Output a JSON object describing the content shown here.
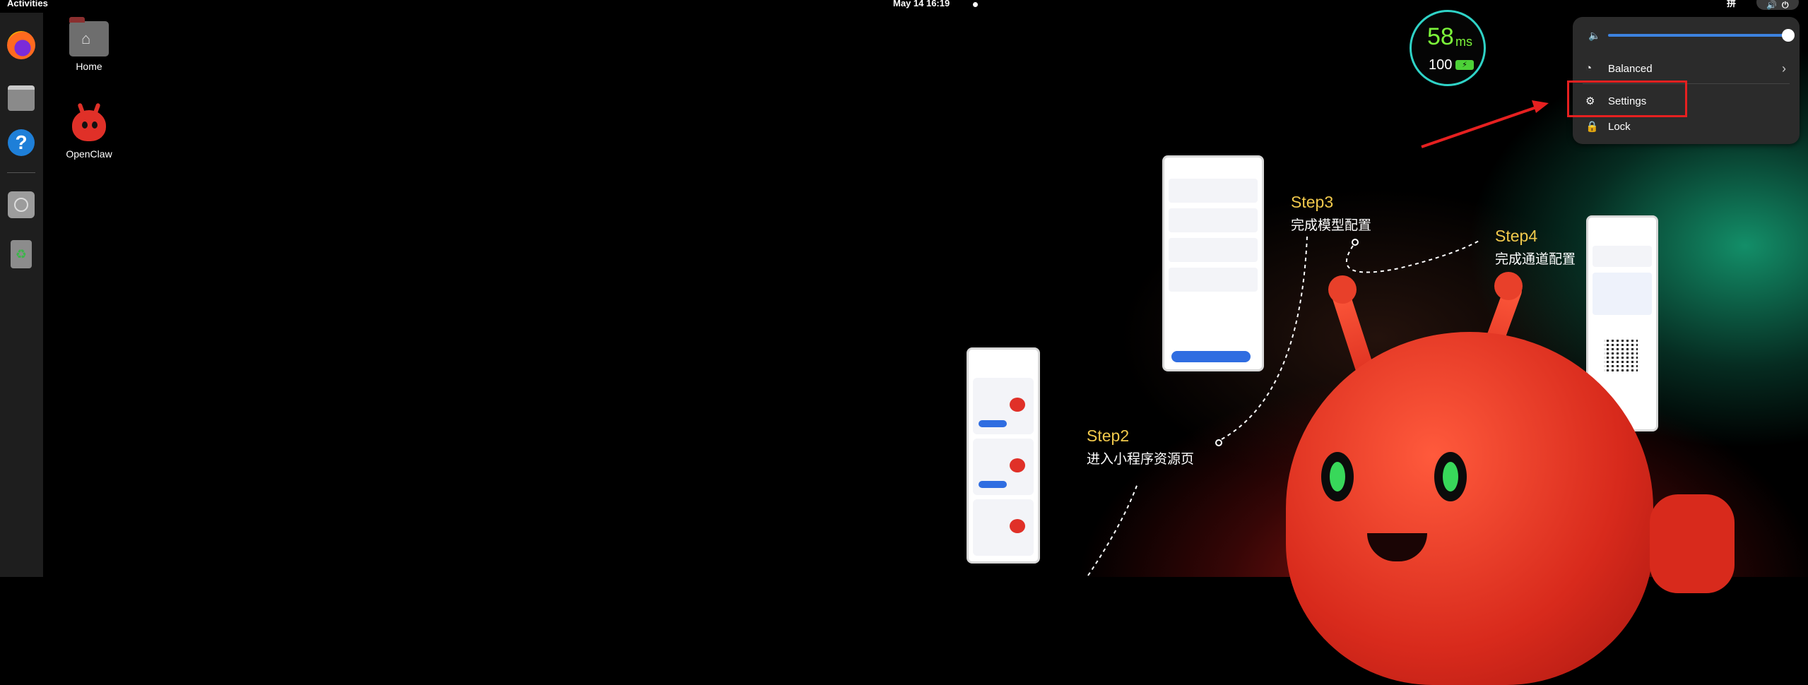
{
  "topbar": {
    "activities": "Activities",
    "clock": "May 14  16:19",
    "input_method": "拼"
  },
  "dock": {
    "items": [
      "firefox-icon",
      "files-icon",
      "help-icon",
      "disc-icon",
      "trash-icon"
    ]
  },
  "desktop": {
    "icons": [
      {
        "label": "Home"
      },
      {
        "label": "OpenClaw"
      }
    ]
  },
  "ping_widget": {
    "latency": "58",
    "unit": "ms",
    "battery": "100"
  },
  "quick_settings": {
    "volume_level": 1.0,
    "power_mode_label": "Balanced",
    "settings_label": "Settings",
    "lock_label": "Lock"
  },
  "steps": [
    {
      "num": "Step2",
      "desc": "进入小程序资源页"
    },
    {
      "num": "Step3",
      "desc": "完成模型配置"
    },
    {
      "num": "Step4",
      "desc": "完成通道配置"
    }
  ],
  "colors": {
    "accent_blue": "#3d83e0",
    "highlight_red": "#e62020",
    "step_gold": "#f1c94c",
    "ping_green": "#7cf53a"
  }
}
